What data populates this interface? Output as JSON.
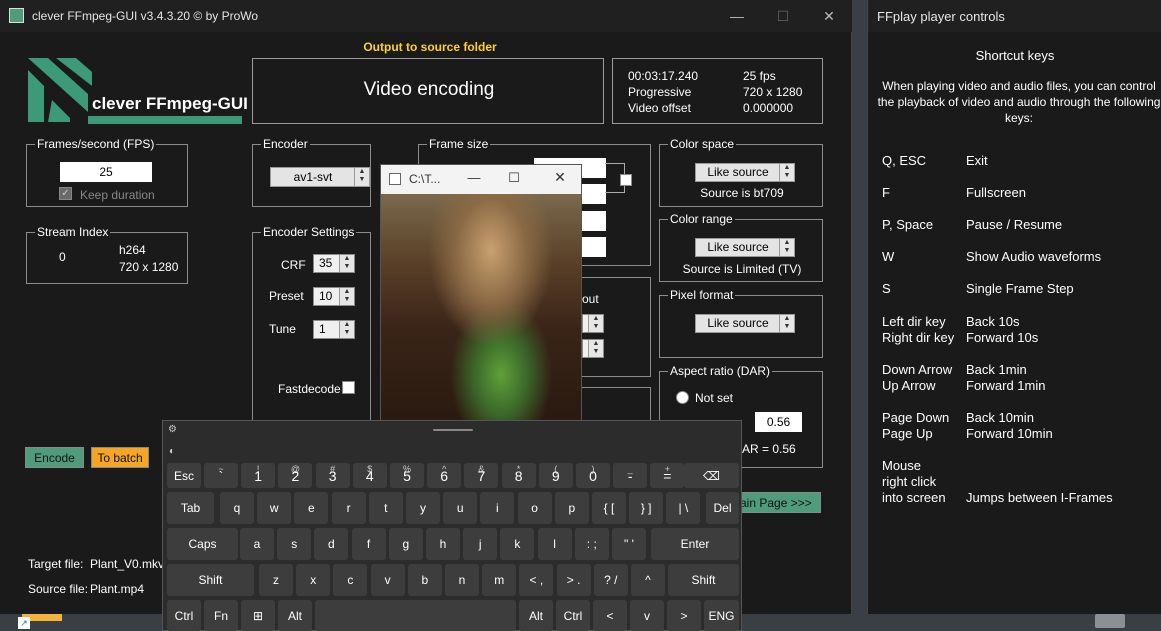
{
  "main_window": {
    "title": "clever FFmpeg-GUI v3.4.3.20   © by ProWo",
    "output_folder": "Output to source folder",
    "logo_text": "clever FFmpeg-GUI",
    "video_encoding": "Video encoding",
    "info": {
      "time": "00:03:17.240",
      "scan": "Progressive",
      "video_offset_label": "Video offset",
      "fps": "25 fps",
      "resolution": "720 x 1280",
      "offset": "0.000000"
    },
    "fps_group": {
      "legend": "Frames/second (FPS)",
      "value": "25",
      "keep_duration": "Keep duration"
    },
    "stream_group": {
      "legend": "Stream Index",
      "index": "0",
      "codec": "h264",
      "resolution": "720 x 1280"
    },
    "encoder_group": {
      "legend": "Encoder",
      "value": "av1-svt"
    },
    "encoder_settings": {
      "legend": "Encoder Settings",
      "crf_label": "CRF",
      "crf": "35",
      "preset_label": "Preset",
      "preset": "10",
      "tune_label": "Tune",
      "tune": "1",
      "fastdecode": "Fastdecode"
    },
    "frame_size": {
      "legend": "Frame size",
      "partial_label": "out"
    },
    "color_space": {
      "legend": "Color space",
      "value": "Like source",
      "source": "Source is bt709"
    },
    "color_range": {
      "legend": "Color range",
      "value": "Like source",
      "source": "Source is Limited (TV)"
    },
    "pixel_format": {
      "legend": "Pixel format",
      "value": "Like source"
    },
    "aspect_ratio": {
      "legend": "Aspect ratio (DAR)",
      "not_set": "Not set",
      "value": "0.56",
      "ar_text": "AR = 0.56"
    },
    "buttons": {
      "encode": "Encode",
      "to_batch": "To batch",
      "main_page": "ain Page >>>"
    },
    "files": {
      "target_label": "Target file:",
      "target": "Plant_V0.mkv",
      "source_label": "Source file:",
      "source": "Plant.mp4"
    }
  },
  "video_window": {
    "title": "C:\\T..."
  },
  "ffplay": {
    "title": "FFplay player controls",
    "heading": "Shortcut keys",
    "description": "When playing video and audio files, you can control the playback of video and audio through the following keys:",
    "shortcuts": [
      {
        "key": "Q, ESC",
        "action": "Exit"
      },
      {
        "key": "F",
        "action": "Fullscreen"
      },
      {
        "key": "P, Space",
        "action": "Pause / Resume"
      },
      {
        "key": "W",
        "action": "Show Audio waveforms"
      },
      {
        "key": "S",
        "action": "Single Frame Step"
      },
      {
        "key": "Left dir key",
        "action": "Back 10s"
      },
      {
        "key": "Right dir key",
        "action": "Forward 10s"
      },
      {
        "key": "Down Arrow",
        "action": "Back 1min"
      },
      {
        "key": "Up Arrow",
        "action": "Forward 1min"
      },
      {
        "key": "Page Down",
        "action": "Back 10min"
      },
      {
        "key": "Page Up",
        "action": "Forward 10min"
      },
      {
        "key": "Mouse",
        "action": ""
      },
      {
        "key": "right click",
        "action": ""
      },
      {
        "key": "into screen",
        "action": "Jumps between I-Frames"
      }
    ]
  },
  "keyboard": {
    "row1": [
      {
        "top": "",
        "main": "Esc"
      },
      {
        "top": "~",
        "main": "`"
      },
      {
        "top": "!",
        "main": "1"
      },
      {
        "top": "@",
        "main": "2"
      },
      {
        "top": "#",
        "main": "3"
      },
      {
        "top": "$",
        "main": "4"
      },
      {
        "top": "%",
        "main": "5"
      },
      {
        "top": "^",
        "main": "6"
      },
      {
        "top": "&",
        "main": "7"
      },
      {
        "top": "*",
        "main": "8"
      },
      {
        "top": "(",
        "main": "9"
      },
      {
        "top": ")",
        "main": "0"
      },
      {
        "top": "_",
        "main": "-"
      },
      {
        "top": "+",
        "main": "="
      },
      {
        "top": "",
        "main": "⌫"
      }
    ],
    "row2": [
      "Tab",
      "q",
      "w",
      "e",
      "r",
      "t",
      "y",
      "u",
      "i",
      "o",
      "p",
      "{ [",
      "} ]",
      "| \\",
      "Del"
    ],
    "row3": [
      "Caps",
      "a",
      "s",
      "d",
      "f",
      "g",
      "h",
      "j",
      "k",
      "l",
      ": ;",
      "\" '",
      "Enter"
    ],
    "row4": [
      "Shift",
      "z",
      "x",
      "c",
      "v",
      "b",
      "n",
      "m",
      "< ,",
      "> .",
      "? /",
      "^",
      "Shift"
    ],
    "row5": [
      "Ctrl",
      "Fn",
      "⊞",
      "Alt",
      "",
      "Alt",
      "Ctrl",
      "<",
      "v",
      ">",
      "ENG"
    ]
  }
}
